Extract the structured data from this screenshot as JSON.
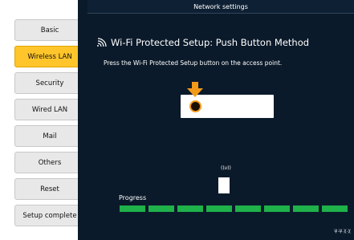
{
  "window": {
    "title": "Network settings"
  },
  "sidebar": {
    "items": [
      {
        "label": "Basic",
        "active": false
      },
      {
        "label": "Wireless LAN",
        "active": true
      },
      {
        "label": "Security",
        "active": false
      },
      {
        "label": "Wired LAN",
        "active": false
      },
      {
        "label": "Mail",
        "active": false
      },
      {
        "label": "Others",
        "active": false
      },
      {
        "label": "Reset",
        "active": false
      },
      {
        "label": "Setup complete",
        "active": false
      }
    ]
  },
  "main": {
    "heading": "Wi-Fi Protected Setup: Push Button Method",
    "heading_icon": "wifi-signal-icon",
    "instruction": "Press the Wi-Fi Protected Setup button on the access point.",
    "signal_text": "((υ))",
    "progress": {
      "label": "Progress",
      "segments_total": 8,
      "segments_filled": 8,
      "fraction": 1.0
    },
    "version": "ψ.ψ.χ.χ"
  },
  "colors": {
    "active_tab": "#ffc52b",
    "background": "#0b1a2a",
    "progress_fill": "#1fb14a",
    "accent_orange": "#f29a1a"
  }
}
